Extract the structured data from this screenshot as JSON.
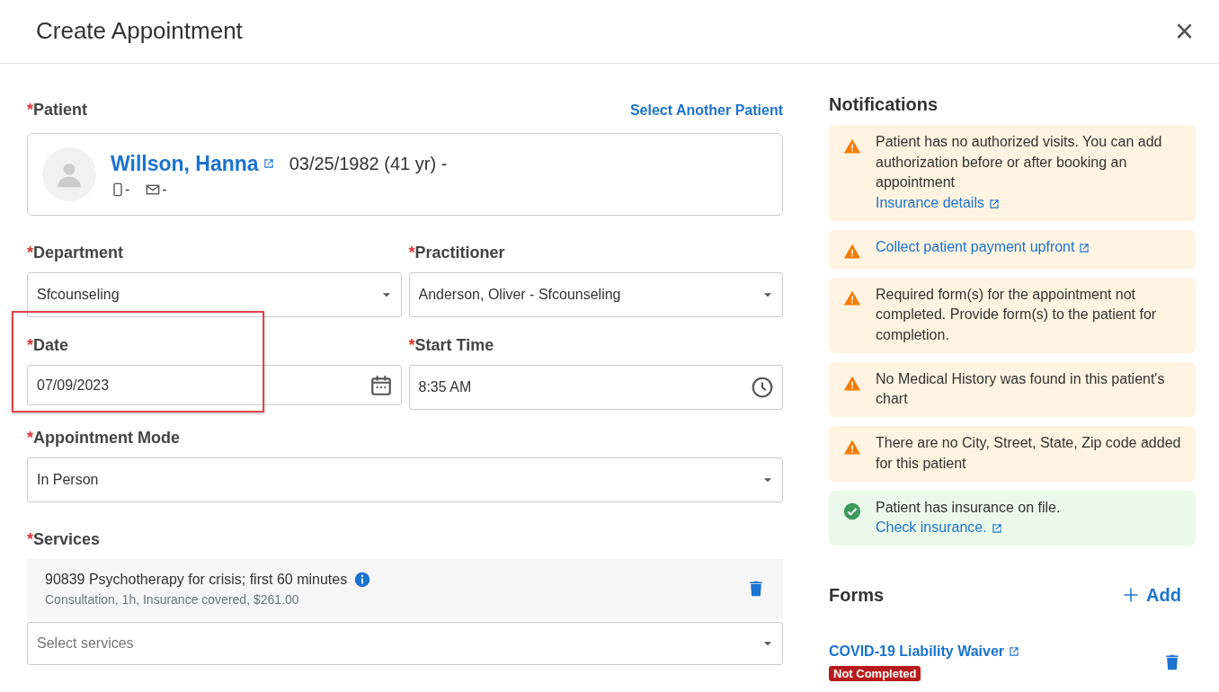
{
  "window": {
    "title": "Create Appointment",
    "close": "×"
  },
  "patient": {
    "mark": "*",
    "label": "Patient",
    "action": "Select Another Patient",
    "name": "Willson, Hanna",
    "dob": "03/25/1982 (41 yr) -",
    "phone": "-",
    "email": "-"
  },
  "field_rows": [
    [
      {
        "kind": "select",
        "mark": "*",
        "label": "Department",
        "value": "Sfcounseling",
        "highlighted": false
      },
      {
        "kind": "select",
        "mark": "*",
        "label": "Practitioner",
        "value": "Anderson, Oliver - Sfcounseling",
        "highlighted": false
      }
    ],
    [
      {
        "kind": "date",
        "mark": "*",
        "label": "Date",
        "value": "07/09/2023",
        "highlighted": true
      },
      {
        "kind": "time",
        "mark": "*",
        "label": "Start Time",
        "value": "8:35 AM",
        "highlighted": false
      }
    ],
    [
      {
        "kind": "select",
        "mark": "*",
        "label": "Appointment Mode",
        "value": "In Person",
        "highlighted": false
      }
    ]
  ],
  "services": {
    "mark": "*",
    "label": "Services",
    "items": [
      {
        "title": "90839 Psychotherapy for crisis; first 60 minutes",
        "details": "Consultation, 1h, Insurance covered, $261.00"
      }
    ],
    "placeholder": "Select services"
  },
  "notifications": {
    "title": "Notifications",
    "items": [
      {
        "kind": "warning",
        "text": "Patient has no authorized visits. You can add authorization before or after booking an appointment",
        "link": "Insurance details"
      },
      {
        "kind": "warning",
        "link": "Collect patient payment upfront"
      },
      {
        "kind": "warning",
        "text": "Required form(s) for the appointment not completed. Provide form(s) to the patient for completion."
      },
      {
        "kind": "warning",
        "text": "No Medical History was found in this patient's chart"
      },
      {
        "kind": "warning",
        "text": "There are no City, Street, State, Zip code added for this patient"
      },
      {
        "kind": "success",
        "text": "Patient has insurance on file.",
        "link": "Check insurance."
      }
    ]
  },
  "forms": {
    "title": "Forms",
    "add": "Add",
    "items": [
      {
        "name": "COVID-19 Liability Waiver",
        "status": "Not Completed"
      }
    ]
  }
}
